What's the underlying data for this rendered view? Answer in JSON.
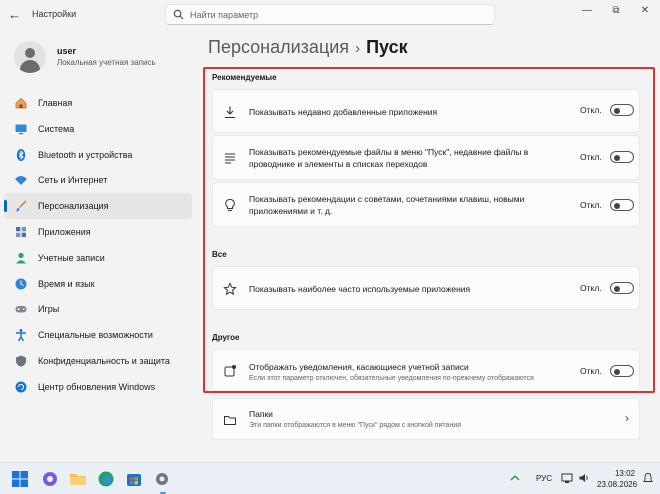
{
  "window": {
    "app_title": "Настройки",
    "search_placeholder": "Найти параметр",
    "controls": {
      "minimize": "—",
      "maximize": "⧉",
      "close": "✕"
    }
  },
  "profile": {
    "name": "user",
    "account_type": "Локальная учетная запись"
  },
  "sidebar": {
    "items": [
      {
        "label": "Главная",
        "icon": "home-icon"
      },
      {
        "label": "Система",
        "icon": "monitor-icon"
      },
      {
        "label": "Bluetooth и устройства",
        "icon": "bluetooth-icon"
      },
      {
        "label": "Сеть и Интернет",
        "icon": "wifi-icon"
      },
      {
        "label": "Персонализация",
        "icon": "brush-icon",
        "active": true
      },
      {
        "label": "Приложения",
        "icon": "apps-icon"
      },
      {
        "label": "Учетные записи",
        "icon": "person-icon"
      },
      {
        "label": "Время и язык",
        "icon": "globe-clock-icon"
      },
      {
        "label": "Игры",
        "icon": "gamepad-icon"
      },
      {
        "label": "Специальные возможности",
        "icon": "accessibility-icon"
      },
      {
        "label": "Конфиденциальность и защита",
        "icon": "shield-icon"
      },
      {
        "label": "Центр обновления Windows",
        "icon": "update-icon"
      }
    ]
  },
  "breadcrumb": {
    "parent": "Персонализация",
    "separator": "›",
    "current": "Пуск"
  },
  "sections": {
    "recommended": "Рекомендуемые",
    "all": "Все",
    "other": "Другое"
  },
  "settings": {
    "recent_apps": {
      "label": "Показывать недавно добавленные приложения",
      "state": "Откл.",
      "on": false
    },
    "recommended_files": {
      "label": "Показывать рекомендуемые файлы в меню \"Пуск\", недавние файлы в проводнике и элементы в списках переходов",
      "state": "Откл.",
      "on": false
    },
    "tips": {
      "label": "Показывать рекомендации с советами, сочетаниями клавиш, новыми приложениями и т. д.",
      "state": "Откл.",
      "on": false
    },
    "most_used": {
      "label": "Показывать наиболее часто используемые приложения",
      "state": "Откл.",
      "on": false
    },
    "account_notifications": {
      "label": "Отображать уведомления, касающиеся учетной записи",
      "sublabel": "Если этот параметр отключен, обязательные уведомления по-прежнему отображаются",
      "state": "Откл.",
      "on": false
    },
    "folders": {
      "label": "Папки",
      "sublabel": "Эти папки отображаются в меню \"Пуск\" рядом с кнопкой питания"
    }
  },
  "taskbar": {
    "language": "РУС",
    "time": "13:02",
    "date": "23.08.2026"
  },
  "colors": {
    "accent": "#0067c0",
    "highlight": "#e0302f"
  }
}
